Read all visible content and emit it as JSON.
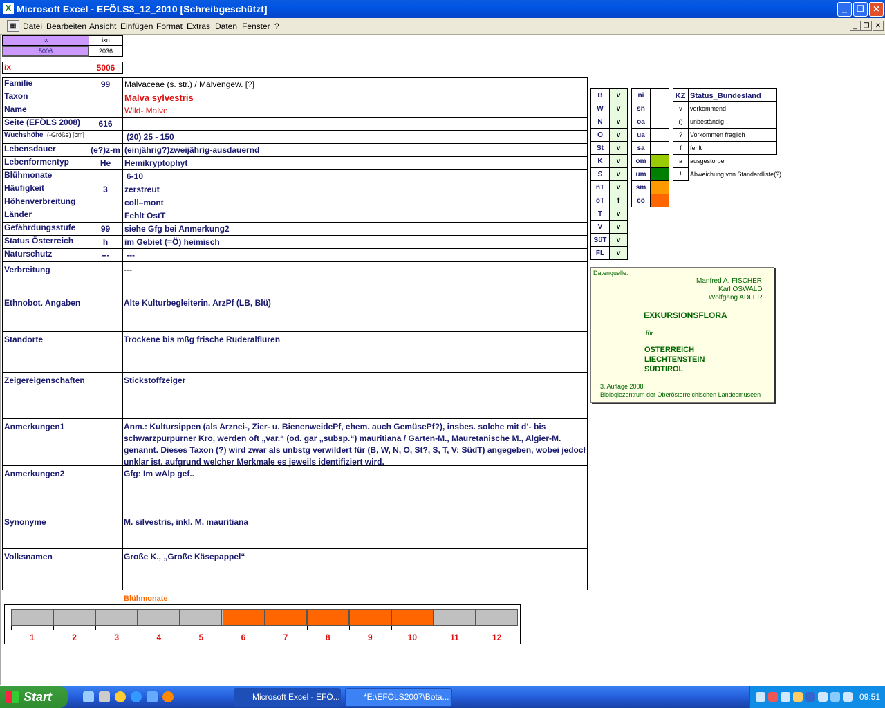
{
  "window": {
    "title": "Microsoft Excel - EFÖLS3_12_2010  [Schreibgeschützt]",
    "minimize": "_",
    "restore": "❐",
    "close": "✕"
  },
  "menu": [
    "Datei",
    "Bearbeiten",
    "Ansicht",
    "Einfügen",
    "Format",
    "Extras",
    "Daten",
    "Fenster",
    "?"
  ],
  "top": {
    "ix_label": "ix",
    "ixn_label": "ixn",
    "ix_value": "5006",
    "ixn_value": "2036",
    "ix2_label": "ix",
    "ix2_value": "5006"
  },
  "fields": [
    {
      "label": "Familie",
      "code": "99",
      "value": "Malvaceae (s. str.)  /  Malvengew. [?]"
    },
    {
      "label": "Taxon",
      "code": "",
      "value": "Malva sylvestris"
    },
    {
      "label": "Name",
      "code": "",
      "value": "Wild- Malve"
    },
    {
      "label": "Seite (EFÖLS 2008)",
      "code": "616",
      "value": ""
    },
    {
      "label": "Wuchshöhe",
      "label_sub": "(-Größe) [cm]",
      "code": "",
      "value": "(20) 25 - 150"
    },
    {
      "label": "Lebensdauer",
      "code": "(e?)z-m",
      "value": "(einjährig?)zweijährig-ausdauernd"
    },
    {
      "label": "Lebenformentyp",
      "code": "He",
      "value": "Hemikryptophyt"
    },
    {
      "label": "Blühmonate",
      "code": "",
      "value": "6-10"
    },
    {
      "label": "Häufigkeit",
      "code": "3",
      "value": "zerstreut"
    },
    {
      "label": "Höhenverbreitung",
      "code": "",
      "value": "coll–mont"
    },
    {
      "label": "Länder",
      "code": "",
      "value": "Fehlt OstT"
    },
    {
      "label": "Gefährdungsstufe",
      "code": "99",
      "value": "siehe Gfg bei Anmerkung2"
    },
    {
      "label": "Status Österreich",
      "code": "h",
      "value": "im Gebiet (=Ö) heimisch"
    },
    {
      "label": "Naturschutz",
      "code": "---",
      "value": "---"
    }
  ],
  "big": [
    {
      "label": "Verbreitung",
      "lines": [
        "---"
      ]
    },
    {
      "label": "Ethnobot. Angaben",
      "lines": [
        "Alte Kulturbegleiterin. ArzPf (LB, Blü)"
      ]
    },
    {
      "label": "Standorte",
      "lines": [
        "Trockene bis mßg frische Ruderalfluren"
      ]
    },
    {
      "label": "Zeigereigenschaften",
      "lines": [
        "Stickstoffzeiger"
      ]
    },
    {
      "label": "Anmerkungen1",
      "lines": [
        "Anm.: Kultursippen (als Arznei-, Zier- u. BienenweidePf, ehem. auch GemüsePf?), insbes. solche mit d’- bis",
        "schwarzpurpurner Kro, werden oft „var.“ (od. gar „subsp.“) mauritiana / Garten-M., Mauretanische M., Algier-M.",
        "genannt. Dieses Taxon (?) wird zwar als unbstg verwildert für (B, W, N, O, St?, S, T, V; SüdT) angegeben, wobei jedoch",
        "unklar ist, aufgrund welcher Merkmale es jeweils identifiziert wird."
      ]
    },
    {
      "label": "Anmerkungen2",
      "lines": [
        "Gfg: Im wAlp gef.."
      ]
    },
    {
      "label": "Synonyme",
      "lines": [
        "M. silvestris, inkl. M. mauritiana"
      ]
    },
    {
      "label": "Volksnamen",
      "lines": [
        "Große K., „Große Käsepappel“"
      ]
    }
  ],
  "states": [
    {
      "code": "B",
      "v": "v"
    },
    {
      "code": "W",
      "v": "v"
    },
    {
      "code": "N",
      "v": "v"
    },
    {
      "code": "O",
      "v": "v"
    },
    {
      "code": "St",
      "v": "v"
    },
    {
      "code": "K",
      "v": "v"
    },
    {
      "code": "S",
      "v": "v"
    },
    {
      "code": "nT",
      "v": "v"
    },
    {
      "code": "oT",
      "v": "f"
    },
    {
      "code": "T",
      "v": "v"
    },
    {
      "code": "V",
      "v": "v"
    },
    {
      "code": "SüT",
      "v": "v"
    },
    {
      "code": "FL",
      "v": "v"
    }
  ],
  "zones": [
    {
      "code": "ni",
      "color": ""
    },
    {
      "code": "sn",
      "color": ""
    },
    {
      "code": "oa",
      "color": ""
    },
    {
      "code": "ua",
      "color": ""
    },
    {
      "code": "sa",
      "color": ""
    },
    {
      "code": "om",
      "color": "#99cc00"
    },
    {
      "code": "um",
      "color": "#008000"
    },
    {
      "code": "sm",
      "color": "#ff9900"
    },
    {
      "code": "co",
      "color": "#ff6600"
    }
  ],
  "legend": {
    "header_kz": "KZ",
    "header_title": "Status_Bundesland",
    "rows": [
      {
        "kz": "v",
        "text": "vorkommend"
      },
      {
        "kz": "()",
        "text": "unbeständig"
      },
      {
        "kz": "?",
        "text": "Vorkommen fraglich"
      },
      {
        "kz": "f",
        "text": "fehlt"
      },
      {
        "kz": "a",
        "text": "ausgestorben"
      },
      {
        "kz": "!",
        "text": "Abweichung von Standardliste(?)"
      }
    ]
  },
  "source": {
    "label": "Datenquelle:",
    "authors": [
      "Manfred A. FISCHER",
      "Karl OSWALD",
      "Wolfgang ADLER"
    ],
    "title": "EXKURSIONSFLORA",
    "fuer": "für",
    "countries": [
      "ÖSTERREICH",
      "LIECHTENSTEIN",
      "SÜDTIROL"
    ],
    "edition": "3. Auflage 2008",
    "publisher": "Biologiezentrum der Oberösterreichischen Landesmuseen"
  },
  "bloom": {
    "title": "Blühmonate",
    "months": [
      "1",
      "2",
      "3",
      "4",
      "5",
      "6",
      "7",
      "8",
      "9",
      "10",
      "11",
      "12"
    ],
    "active": [
      6,
      7,
      8,
      9,
      10
    ],
    "active_color": "#ff6600",
    "inactive_color": "#c0c0c0"
  },
  "taskbar": {
    "start": "Start",
    "tasks": [
      "Microsoft Excel - EFÖ...",
      "*E:\\EFÖLS2007\\Bota..."
    ],
    "clock": "09:51"
  }
}
